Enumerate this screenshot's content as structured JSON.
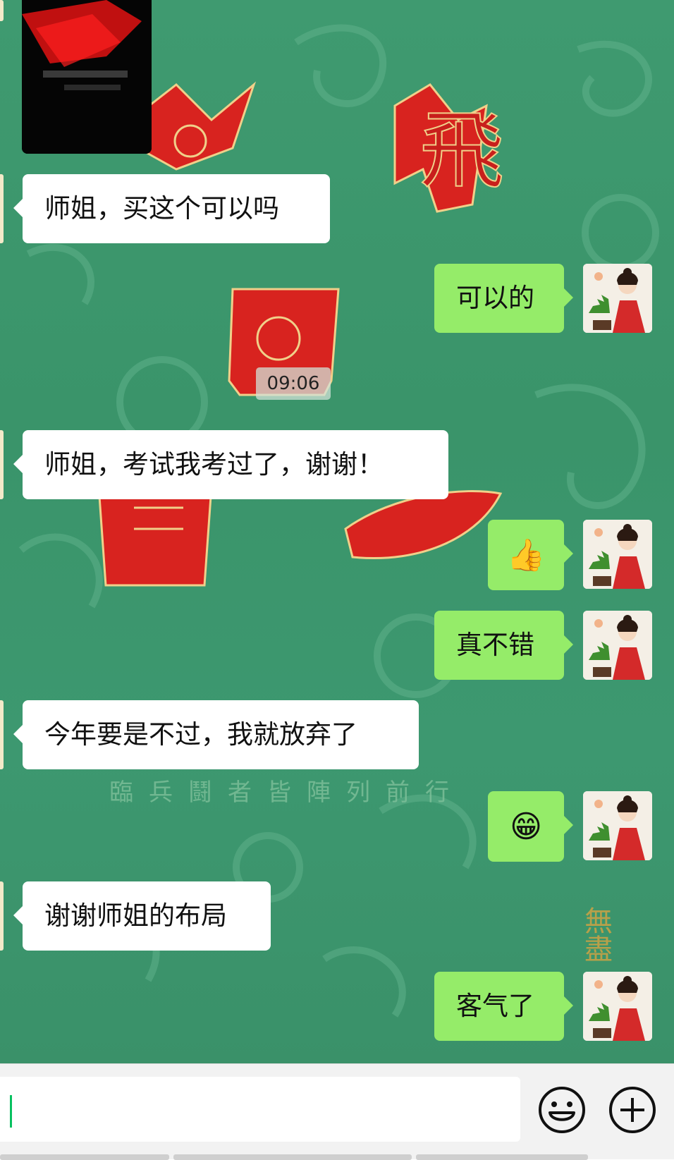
{
  "chat": {
    "timestamp": "09:06",
    "messages": [
      {
        "side": "left",
        "text": "师姐，买这个可以吗"
      },
      {
        "side": "right",
        "text": "可以的"
      },
      {
        "side": "left",
        "text": "师姐，考试我考过了，谢谢！"
      },
      {
        "side": "right",
        "text": "👍"
      },
      {
        "side": "right",
        "text": "真不错"
      },
      {
        "side": "left",
        "text": "今年要是不过，我就放弃了"
      },
      {
        "side": "right",
        "text": "😁"
      },
      {
        "side": "left",
        "text": "谢谢师姐的布局"
      },
      {
        "side": "right",
        "text": "客气了"
      }
    ]
  },
  "background_art": {
    "subtitle": "臨兵鬪者皆陣列前行",
    "big_char": "飛",
    "side_text": "無盡"
  },
  "input": {
    "value": "",
    "icons": [
      "emoji-icon",
      "plus-icon"
    ]
  },
  "colors": {
    "chat_bg": "#3d9870",
    "self_bubble": "#95ec69",
    "other_bubble": "#ffffff",
    "caret": "#07c160"
  }
}
